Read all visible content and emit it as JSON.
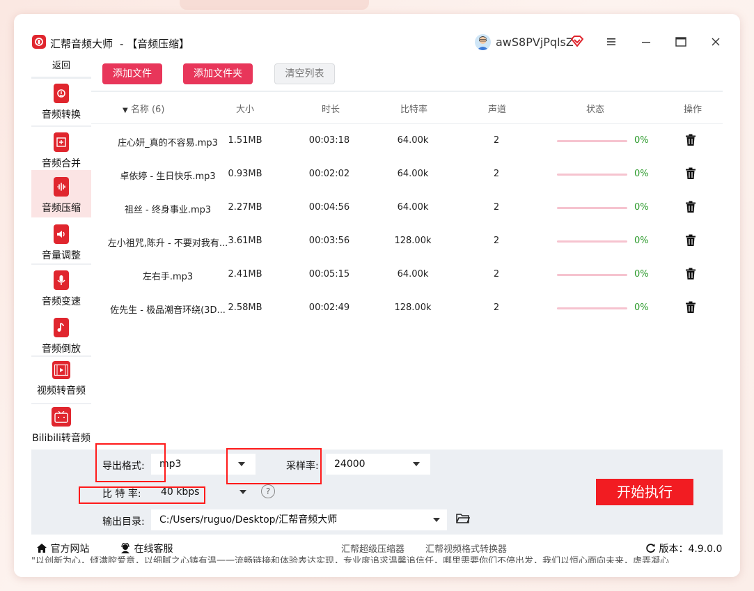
{
  "window": {
    "app_name": "汇帮音频大师",
    "subtitle": "- 【音频压缩】",
    "username": "awS8PVjPqlsZ"
  },
  "sidebar": {
    "back_label": "返回",
    "items": [
      {
        "label": "音频转换",
        "icon": "audio-convert-icon"
      },
      {
        "label": "音频合并",
        "icon": "audio-merge-icon"
      },
      {
        "label": "音频压缩",
        "icon": "audio-compress-icon"
      },
      {
        "label": "音量调整",
        "icon": "volume-icon"
      },
      {
        "label": "音频变速",
        "icon": "microphone-icon"
      },
      {
        "label": "音频倒放",
        "icon": "music-note-icon"
      },
      {
        "label": "视频转音频",
        "icon": "film-icon"
      },
      {
        "label": "Bilibili转音频",
        "icon": "tv-icon"
      }
    ],
    "active_index": 2
  },
  "toolbar": {
    "add_file": "添加文件",
    "add_folder": "添加文件夹",
    "clear_list": "清空列表"
  },
  "table": {
    "headers": {
      "name": "名称 (6)",
      "size": "大小",
      "duration": "时长",
      "bitrate": "比特率",
      "channels": "声道",
      "status": "状态",
      "action": "操作"
    },
    "rows": [
      {
        "name": "庄心妍_真的不容易.mp3",
        "size": "1.51MB",
        "duration": "00:03:18",
        "bitrate": "64.00k",
        "channels": "2",
        "progress": "0%"
      },
      {
        "name": "卓依婷 - 生日快乐.mp3",
        "size": "0.93MB",
        "duration": "00:02:02",
        "bitrate": "64.00k",
        "channels": "2",
        "progress": "0%"
      },
      {
        "name": "祖丝 - 终身事业.mp3",
        "size": "2.27MB",
        "duration": "00:04:56",
        "bitrate": "64.00k",
        "channels": "2",
        "progress": "0%"
      },
      {
        "name": "左小祖咒,陈升 - 不要对我有...",
        "size": "3.61MB",
        "duration": "00:03:56",
        "bitrate": "128.00k",
        "channels": "2",
        "progress": "0%"
      },
      {
        "name": "左右手.mp3",
        "size": "2.41MB",
        "duration": "00:05:15",
        "bitrate": "64.00k",
        "channels": "2",
        "progress": "0%"
      },
      {
        "name": "佐先生 - 极品潮音环绕(3D...",
        "size": "2.58MB",
        "duration": "00:02:49",
        "bitrate": "128.00k",
        "channels": "2",
        "progress": "0%"
      }
    ]
  },
  "settings": {
    "format_label": "导出格式:",
    "format_value": "mp3",
    "sample_rate_label": "采样率:",
    "sample_rate_value": "24000",
    "bitrate_label": "比 特 率:",
    "bitrate_value": "40 kbps",
    "help_symbol": "?",
    "output_label": "输出目录:",
    "output_value": "C:/Users/ruguo/Desktop/汇帮音频大师",
    "start_label": "开始执行"
  },
  "footer": {
    "website": "官方网站",
    "support": "在线客服",
    "link1": "汇帮超级压缩器",
    "link2": "汇帮视频格式转换器",
    "version": "版本：4.9.0.0",
    "ticker": "\"以创新为心，倾满腔爱意，以细腻之心铸有温一一流畅链接和体验表达实现，专业度追求温馨追信任，哪里需要你们不停出发，我们以恒心面向未来，虚弄凝心"
  },
  "colors": {
    "brand_red": "#e0262e",
    "button_pink": "#e8365a",
    "start_red": "#f21c22",
    "progress_pink": "#f6c3cf",
    "percent_green": "#2b9a2b",
    "highlight_box": "#ff1a1a"
  }
}
